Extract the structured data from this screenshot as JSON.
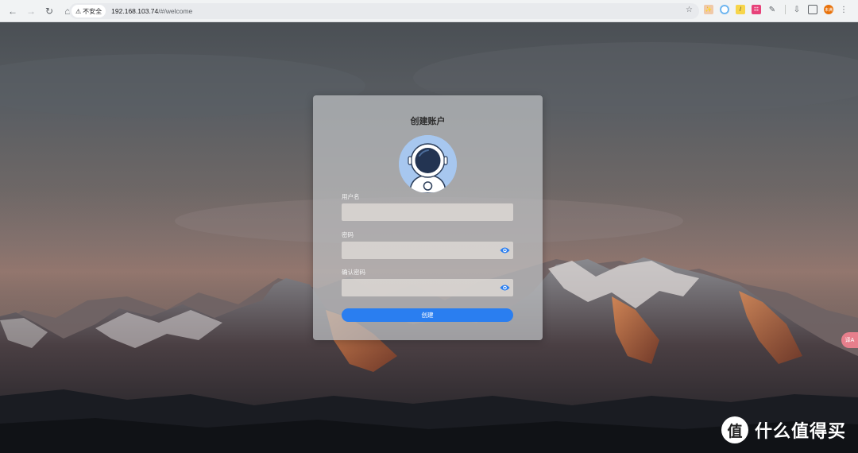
{
  "browser": {
    "security_label": "不安全",
    "url_host": "192.168.103.74",
    "url_path": "/#/welcome",
    "profile_initials": "未满",
    "colors": {
      "chrome_bg": "#f1f3f4",
      "omnibox_bg": "#e8eaed"
    },
    "icons": [
      "back-icon",
      "forward-icon",
      "reload-icon",
      "home-icon",
      "warning-icon",
      "star-icon",
      "extensions-icon",
      "side-panel-icon",
      "download-icon",
      "menu-icon"
    ]
  },
  "form": {
    "title": "创建账户",
    "username_label": "用户名",
    "username_value": "",
    "password_label": "密码",
    "password_value": "",
    "confirm_label": "确认密码",
    "confirm_value": "",
    "submit_label": "创建",
    "colors": {
      "accent": "#2a7ef0",
      "avatar_bg": "#a7c7ef"
    }
  },
  "side_tab": {
    "label": "译A"
  },
  "watermark": {
    "logo_char": "值",
    "text": "什么值得买"
  }
}
